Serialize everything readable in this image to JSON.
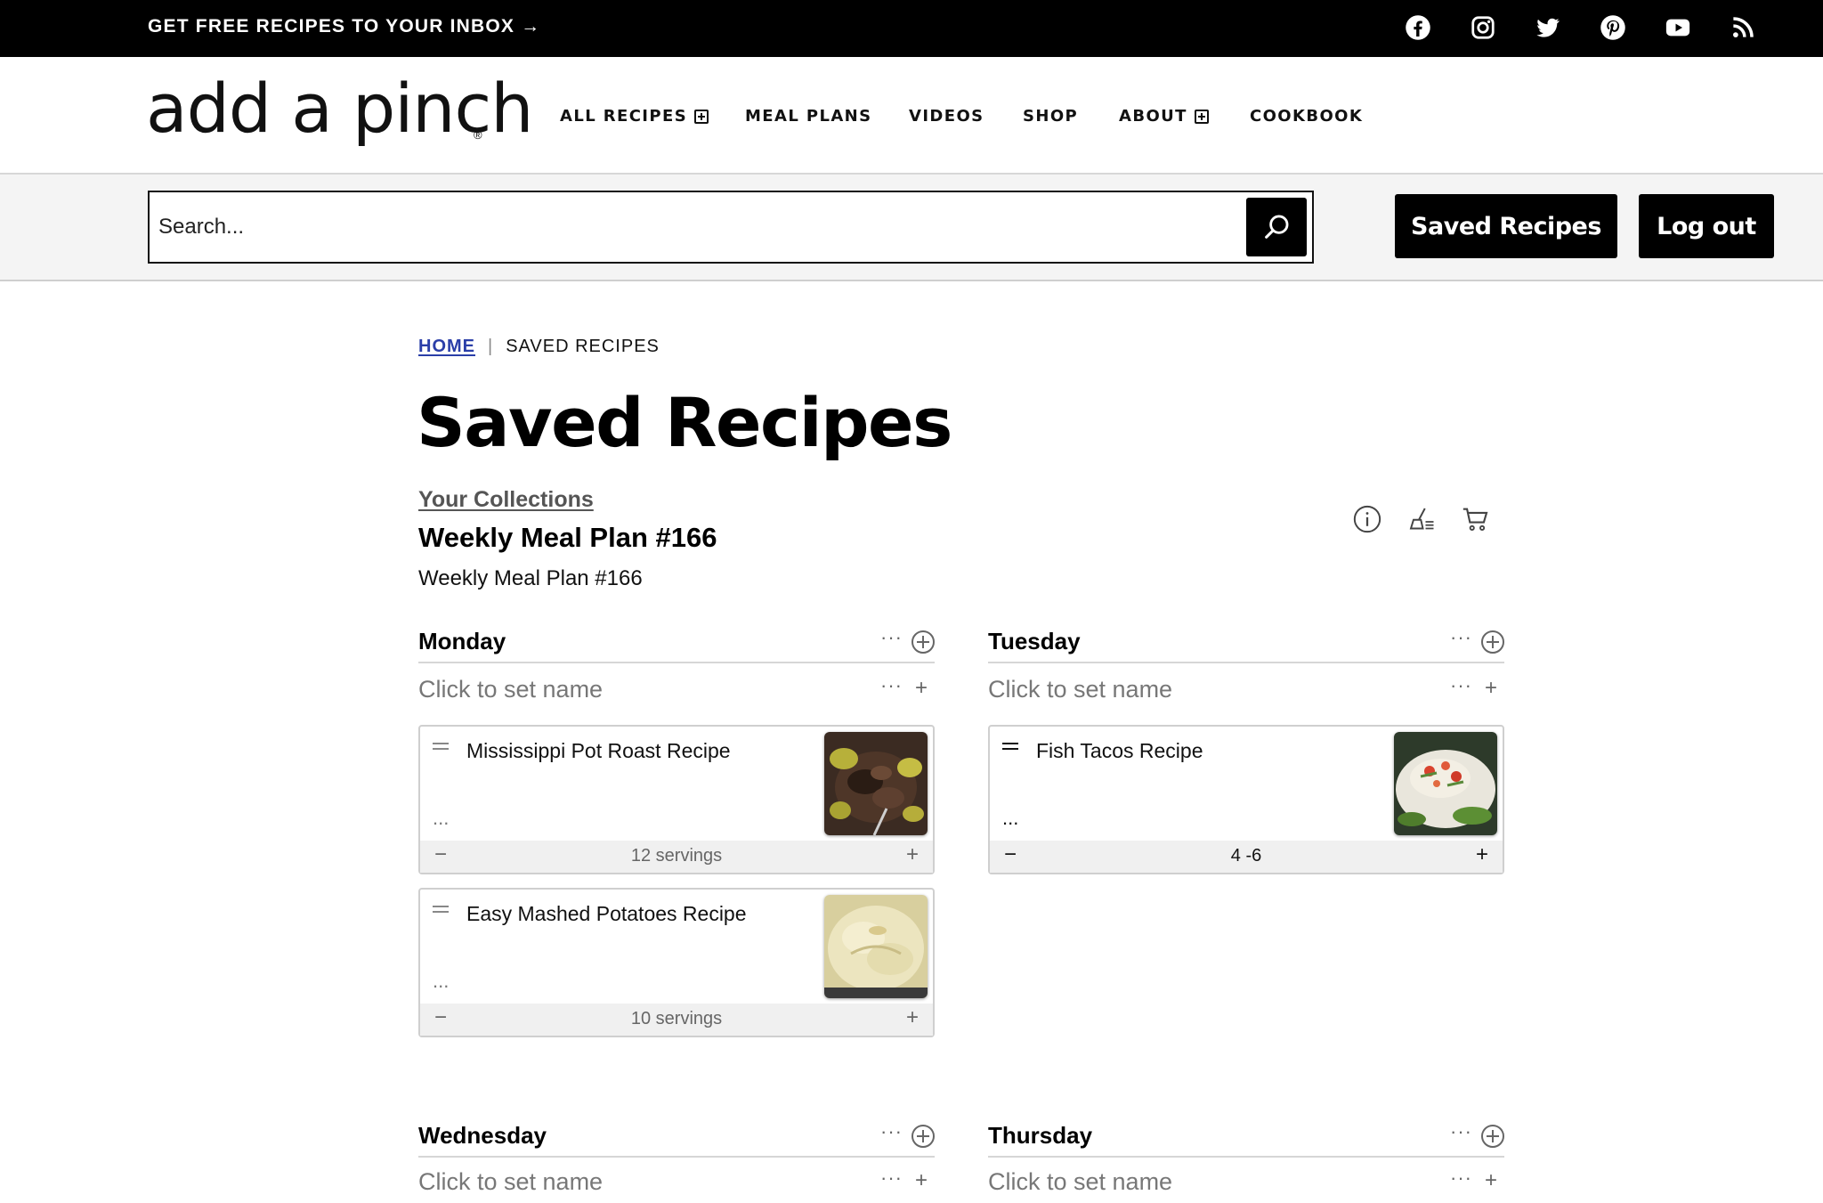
{
  "topbar": {
    "promo": "GET FREE RECIPES TO YOUR INBOX →",
    "social_icons": [
      "facebook-icon",
      "instagram-icon",
      "twitter-icon",
      "pinterest-icon",
      "youtube-icon",
      "rss-icon"
    ]
  },
  "header": {
    "logo": "add a pinch",
    "nav": [
      {
        "label": "ALL RECIPES",
        "has_submenu": true
      },
      {
        "label": "MEAL PLANS",
        "has_submenu": false
      },
      {
        "label": "VIDEOS",
        "has_submenu": false
      },
      {
        "label": "SHOP",
        "has_submenu": false
      },
      {
        "label": "ABOUT",
        "has_submenu": true
      },
      {
        "label": "COOKBOOK",
        "has_submenu": false
      }
    ]
  },
  "search": {
    "placeholder": "Search...",
    "saved_label": "Saved Recipes",
    "logout_label": "Log out"
  },
  "breadcrumb": {
    "home": "HOME",
    "separator": "|",
    "current": "SAVED RECIPES"
  },
  "page": {
    "title": "Saved Recipes",
    "collections_link": "Your Collections",
    "plan_title": "Weekly Meal Plan #166",
    "plan_description": "Weekly Meal Plan #166",
    "tools": [
      "info-icon",
      "cleanup-icon",
      "shopping-cart-icon"
    ]
  },
  "days": [
    {
      "name": "Monday",
      "meal_placeholder": "Click to set name",
      "dots": "···",
      "recipes": [
        {
          "name": "Mississippi Pot Roast Recipe",
          "servings": "12",
          "servings_unit": "servings"
        },
        {
          "name": "Easy Mashed Potatoes Recipe",
          "servings": "10",
          "servings_unit": "servings"
        }
      ]
    },
    {
      "name": "Tuesday",
      "meal_placeholder": "Click to set name",
      "dots": "···",
      "recipes": [
        {
          "name": "Fish Tacos Recipe",
          "servings": "4 -6",
          "servings_unit": ""
        }
      ]
    },
    {
      "name": "Wednesday",
      "meal_placeholder": "Click to set name",
      "dots": "···",
      "recipes": []
    },
    {
      "name": "Thursday",
      "meal_placeholder": "Click to set name",
      "dots": "···",
      "recipes": []
    }
  ],
  "glyphs": {
    "minus": "−",
    "plus": "+",
    "card_dots": "..."
  }
}
